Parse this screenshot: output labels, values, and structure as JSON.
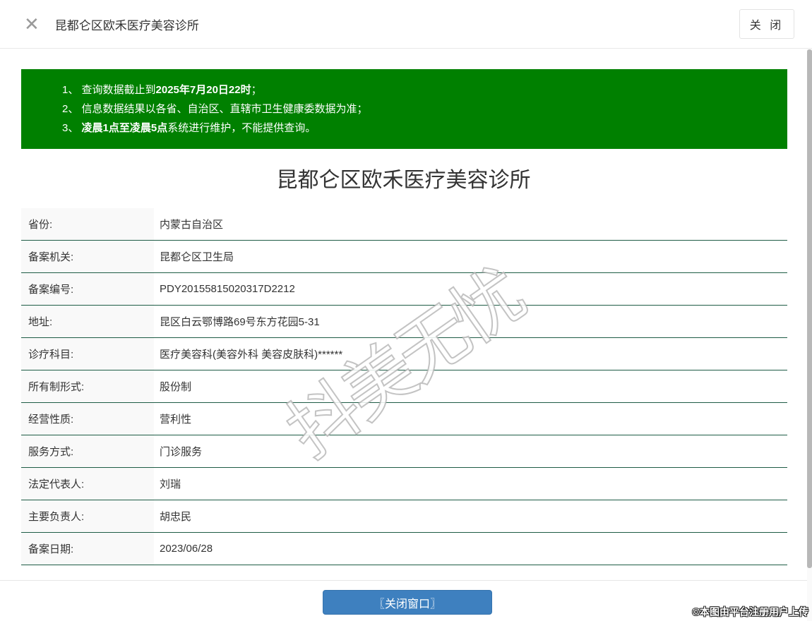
{
  "header": {
    "close_icon": "✕",
    "title": "昆都仑区欧禾医疗美容诊所",
    "close_button_label": "关 闭"
  },
  "notice": {
    "bg_color": "#008000",
    "lines": [
      {
        "prefix": "1、 查询数据截止到",
        "bold": "2025年7月20日22时",
        "suffix": "；"
      },
      {
        "prefix": "2、 信息数据结果以各省、自治区、直辖市卫生健康委数据为准；",
        "bold": "",
        "suffix": ""
      },
      {
        "prefix": "3、 ",
        "bold": "凌晨1点至凌晨5点",
        "suffix": "系统进行维护，不能提供查询。"
      }
    ]
  },
  "main": {
    "title": "昆都仑区欧禾医疗美容诊所",
    "fields": [
      {
        "label": "省份:",
        "value": "内蒙古自治区"
      },
      {
        "label": "备案机关:",
        "value": "昆都仑区卫生局"
      },
      {
        "label": "备案编号:",
        "value": "PDY20155815020317D2212"
      },
      {
        "label": "地址:",
        "value": "昆区白云鄂博路69号东方花园5-31"
      },
      {
        "label": "诊疗科目:",
        "value": "医疗美容科(美容外科 美容皮肤科)******"
      },
      {
        "label": "所有制形式:",
        "value": "股份制"
      },
      {
        "label": "经营性质:",
        "value": "营利性"
      },
      {
        "label": "服务方式:",
        "value": "门诊服务"
      },
      {
        "label": "法定代表人:",
        "value": "刘瑞"
      },
      {
        "label": "主要负责人:",
        "value": "胡忠民"
      },
      {
        "label": "备案日期:",
        "value": "2023/06/28"
      }
    ]
  },
  "footer": {
    "close_window_button_label": "〖关闭窗口〗"
  },
  "watermarks": {
    "diagonal_text": "抖美无忧",
    "corner_text": "©本图由平台注册用户上传"
  },
  "colors": {
    "notice_green": "#008000",
    "table_border_green": "#1e5c45",
    "button_blue": "#3e80bf",
    "label_column_bg": "#f9f9f9"
  }
}
